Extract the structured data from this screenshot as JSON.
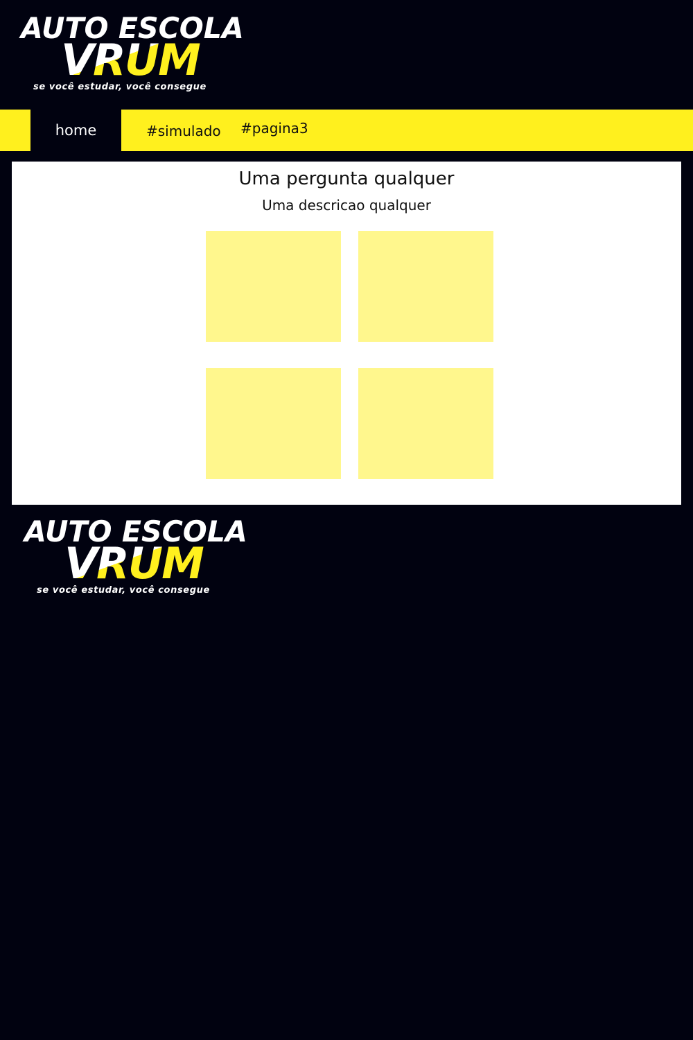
{
  "logo": {
    "line1": "AUTO ESCOLA",
    "line2": "VRUM",
    "tagline": "se você estudar, você consegue"
  },
  "nav": {
    "home": "home",
    "simulado": "#simulado",
    "pagina3": "#pagina3"
  },
  "question": {
    "title": "Uma pergunta qualquer",
    "description": "Uma descricao qualquer",
    "options": [
      "",
      "",
      "",
      ""
    ]
  },
  "colors": {
    "background": "#010210",
    "accent": "#fff01e",
    "option": "#fff78d",
    "panel": "#ffffff"
  }
}
